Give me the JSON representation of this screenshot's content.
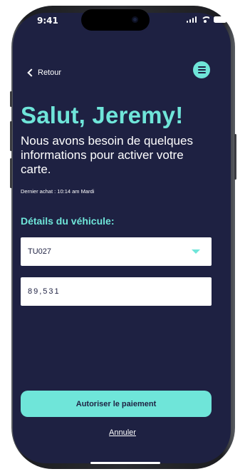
{
  "status_bar": {
    "time": "9:41"
  },
  "nav": {
    "back_label": "Retour"
  },
  "content": {
    "greeting": "Salut, Jeremy!",
    "intro": "Nous avons besoin de quelques informations pour activer votre carte.",
    "last_purchase": "Dernier achat : 10:14 am Mardi",
    "section_title": "Détails du véhicule:"
  },
  "form": {
    "vehicle_select_value": "TU027",
    "odometer_value": "89,531"
  },
  "actions": {
    "authorize_label": "Autoriser le paiement",
    "cancel_label": "Annuler"
  },
  "colors": {
    "background": "#1e2142",
    "accent": "#6fe5d9",
    "text": "#ffffff"
  },
  "icons": [
    "back-chevron-icon",
    "menu-icon",
    "dropdown-caret-icon",
    "signal-icon",
    "wifi-icon",
    "battery-icon"
  ]
}
